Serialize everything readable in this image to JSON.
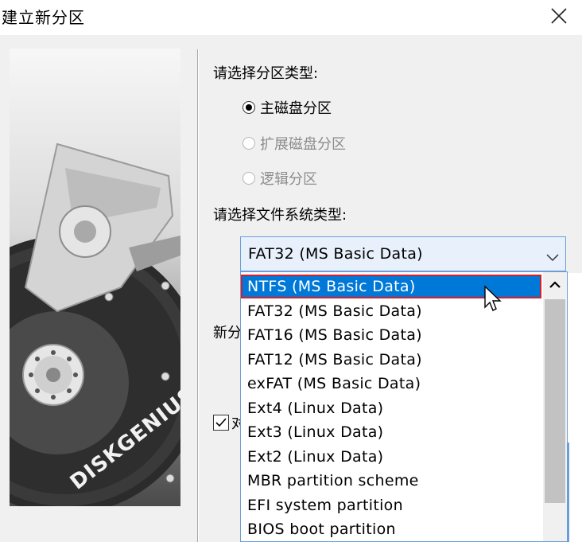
{
  "window": {
    "title": "建立新分区",
    "close_icon": "close-icon"
  },
  "partition_type": {
    "label": "请选择分区类型:",
    "options": [
      {
        "label": "主磁盘分区",
        "selected": true,
        "enabled": true
      },
      {
        "label": "扩展磁盘分区",
        "selected": false,
        "enabled": false
      },
      {
        "label": "逻辑分区",
        "selected": false,
        "enabled": false
      }
    ]
  },
  "filesystem": {
    "label": "请选择文件系统类型:",
    "current_value": "FAT32 (MS Basic Data)",
    "options": [
      "NTFS (MS Basic Data)",
      "FAT32 (MS Basic Data)",
      "FAT16 (MS Basic Data)",
      "FAT12 (MS Basic Data)",
      "exFAT (MS Basic Data)",
      "Ext4 (Linux Data)",
      "Ext3 (Linux Data)",
      "Ext2 (Linux Data)",
      "MBR partition scheme",
      "EFI system partition",
      "BIOS boot partition"
    ],
    "highlighted_index": 0
  },
  "partially_hidden": {
    "size_label_fragment": "新分",
    "checkbox_label_fragment": "对",
    "checkbox_checked": true
  },
  "brand": {
    "text": "DISKGENIUS"
  },
  "colors": {
    "selection": "#0078d7",
    "highlight_box": "#e01b24",
    "dropdown_border": "#6b9ed8"
  }
}
